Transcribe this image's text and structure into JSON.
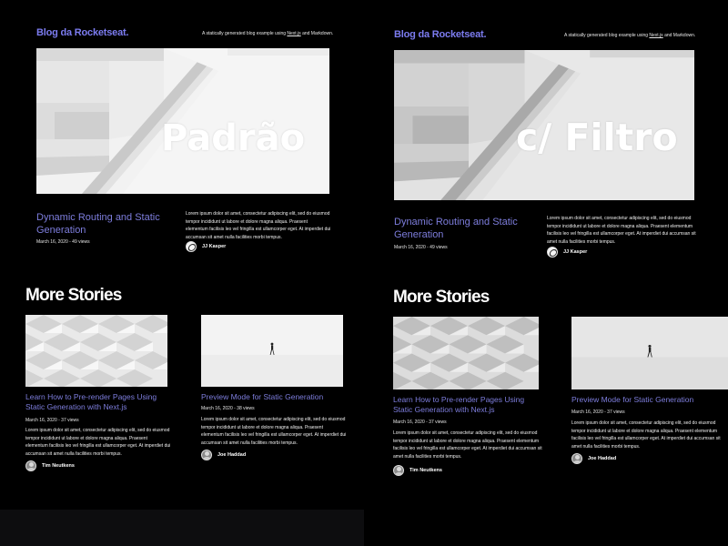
{
  "panels": [
    {
      "id": "default",
      "logo": "Blog da Rocketseat.",
      "tagline_before": "A statically generated blog example using ",
      "tagline_link": "Next.js",
      "tagline_after": " and Markdown.",
      "hero_label": "Padrão",
      "hero_post": {
        "title": "Dynamic Routing and Static Generation",
        "meta": "March 16, 2020 - 49 views",
        "excerpt": "Lorem ipsum dolor sit amet, consectetur adipiscing elit, sed do eiusmod tempor incididunt ut labore et dolore magna aliqua. Praesent elementum facilisis leo vel fringilla est ullamcorper eget. At imperdiet dui accumsan sit amet nulla facilities morbi tempus.",
        "author": "JJ Kasper"
      },
      "more_stories_heading": "More Stories",
      "stories": [
        {
          "title": "Learn How to Pre-render Pages Using Static Generation with Next.js",
          "meta": "March 16, 2020 - 37 views",
          "excerpt": "Lorem ipsum dolor sit amet, consectetur adipiscing elit, sed do eiusmod tempor incididunt ut labore et dolore magna aliqua. Praesent elementum facilisis leo vel fringilla est ullamcorper eget. At imperdiet dui accumsan sit amet nulla facilities morbi tempus.",
          "author": "Tim Neutkens"
        },
        {
          "title": "Preview Mode for Static Generation",
          "meta": "March 16, 2020 - 38 views",
          "excerpt": "Lorem ipsum dolor sit amet, consectetur adipiscing elit, sed do eiusmod tempor incididunt ut labore et dolore magna aliqua. Praesent elementum facilisis leo vel fringilla est ullamcorper eget. At imperdiet dui accumsan sit amet nulla facilities morbi tempus.",
          "author": "Joe Haddad"
        }
      ]
    },
    {
      "id": "filtered",
      "logo": "Blog da Rocketseat.",
      "tagline_before": "A statically generated blog example using ",
      "tagline_link": "Next.js",
      "tagline_after": " and Markdown.",
      "hero_label": "c/ Filtro",
      "hero_post": {
        "title": "Dynamic Routing and Static Generation",
        "meta": "March 16, 2020 - 49 views",
        "excerpt": "Lorem ipsum dolor sit amet, consectetur adipiscing elit, sed do eiusmod tempor incididunt ut labore et dolore magna aliqua. Praesent elementum facilisis leo vel fringilla est ullamcorper eget. At imperdiet dui accumsan sit amet nulla facilities morbi tempus.",
        "author": "JJ Kasper"
      },
      "more_stories_heading": "More Stories",
      "stories": [
        {
          "title": "Learn How to Pre-render Pages Using Static Generation with Next.js",
          "meta": "March 16, 2020 - 37 views",
          "excerpt": "Lorem ipsum dolor sit amet, consectetur adipiscing elit, sed do eiusmod tempor incididunt ut labore et dolore magna aliqua. Praesent elementum facilisis leo vel fringilla est ullamcorper eget. At imperdiet dui accumsan sit amet nulla facilities morbi tempus.",
          "author": "Tim Neutkens"
        },
        {
          "title": "Preview Mode for Static Generation",
          "meta": "March 16, 2020 - 37 views",
          "excerpt": "Lorem ipsum dolor sit amet, consectetur adipiscing elit, sed do eiusmod tempor incididunt ut labore et dolore magna aliqua. Praesent elementum facilisis leo vel fringilla est ullamcorper eget. At imperdiet dui accumsan sit amet nulla facilities morbi tempus.",
          "author": "Joe Haddad"
        }
      ]
    }
  ],
  "colors": {
    "background": "#000000",
    "logo": "#7c7cf0",
    "title_link": "#7d7ddc",
    "text": "#ffffff"
  },
  "icons": {
    "author_avatar_hero": "rocketseat-logo-icon",
    "author_avatar_story": "person-photo-icon"
  }
}
